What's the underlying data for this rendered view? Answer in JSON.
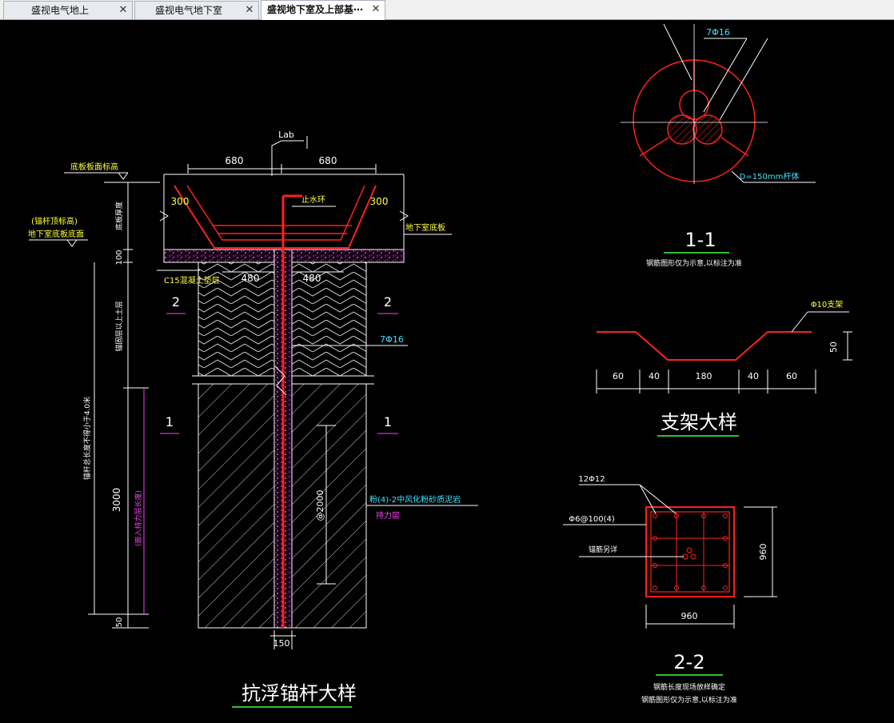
{
  "tabs": [
    {
      "label": "盛视电气地上",
      "active": false
    },
    {
      "label": "盛视电气地下室",
      "active": false
    },
    {
      "label": "盛视地下室及上部基⋯",
      "active": true
    }
  ],
  "close_glyph": "✕",
  "colors": {
    "background": "#000000",
    "red": "#ff2020",
    "white": "#ffffff",
    "yellow": "#ffff40",
    "cyan": "#40e0ff",
    "magenta": "#ff40ff",
    "green": "#40ff40"
  },
  "main_detail": {
    "title": "抗浮锚杆大样",
    "lab": "Lab",
    "dim_680_left": "680",
    "dim_680_right": "680",
    "dim_300_left": "300",
    "dim_300_right": "300",
    "dim_480_left": "480",
    "dim_480_right": "480",
    "dim_100": "100",
    "dim_3000": "3000",
    "dim_50": "50",
    "dim_150": "150",
    "spacing_2000": "@2000",
    "label_bottom_plate_top": "底板板面标高",
    "label_water_stop": "止水环",
    "label_basement_floor": "地下室底板",
    "label_anchor_elev": "(锚杆顶标高)",
    "label_basement_bottom": "地下室底板底面",
    "label_c15": "C15混凝土垫层",
    "label_plate_thickness": "底板厚度",
    "label_soil_above": "锚固层以上土层",
    "label_anchor_length": "锚杆总长度不得小于4.0米",
    "label_embed": "(嵌入持力层长度)",
    "rebar_7phi16": "7Φ16",
    "layer_name": "粉(4)-2中风化粉砂质泥岩",
    "layer_bearing": "持力层",
    "section_2_left": "2",
    "section_2_right": "2",
    "section_1_left": "1",
    "section_1_right": "1"
  },
  "section_1_1": {
    "title": "1-1",
    "note": "钢筋图形仅为示意,以标注为准",
    "rebar": "7Φ16",
    "diameter": "D=150mm杆体"
  },
  "bracket_detail": {
    "title": "支架大样",
    "label": "Φ10支架",
    "dims": [
      "60",
      "40",
      "180",
      "40",
      "60"
    ],
    "height": "50"
  },
  "section_2_2": {
    "title": "2-2",
    "note1": "钢筋长度现场放样确定",
    "note2": "钢筋图形仅为示意,以标注为准",
    "rebar_12": "12Φ12",
    "stirrup": "Φ6@100(4)",
    "anchor_rebar": "锚筋另详",
    "width": "960",
    "height": "960"
  }
}
